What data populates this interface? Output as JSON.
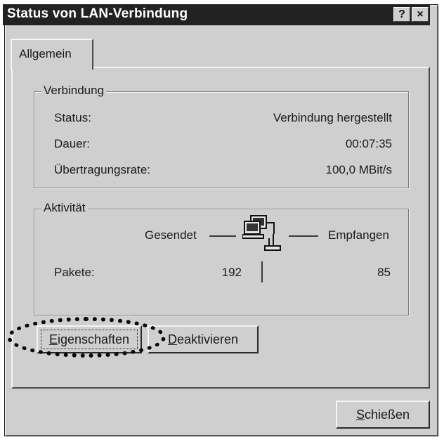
{
  "window": {
    "title": "Status von LAN-Verbindung",
    "help_button": "?",
    "close_button": "×"
  },
  "tabs": [
    {
      "label": "Allgemein",
      "selected": true
    }
  ],
  "connection": {
    "group_label": "Verbindung",
    "rows": [
      {
        "label": "Status:",
        "value": "Verbindung hergestellt"
      },
      {
        "label": "Dauer:",
        "value": "00:07:35"
      },
      {
        "label": "Übertragungsrate:",
        "value": "100,0 MBit/s"
      }
    ]
  },
  "activity": {
    "group_label": "Aktivität",
    "sent_label": "Gesendet",
    "received_label": "Empfangen",
    "packets_label": "Pakete:",
    "packets_sent": "192",
    "packets_received": "85",
    "icon": "network-computers-icon"
  },
  "buttons": {
    "properties": {
      "prefix": "",
      "mnemonic": "E",
      "rest": "igenschaften"
    },
    "deactivate": {
      "prefix": "",
      "mnemonic": "D",
      "rest": "eaktivieren"
    },
    "close": {
      "prefix": "",
      "mnemonic": "S",
      "rest": "chießen"
    }
  },
  "colors": {
    "titlebar": "#222222",
    "face": "#cfcfcf",
    "highlight_ring": "#0a0a0a"
  }
}
